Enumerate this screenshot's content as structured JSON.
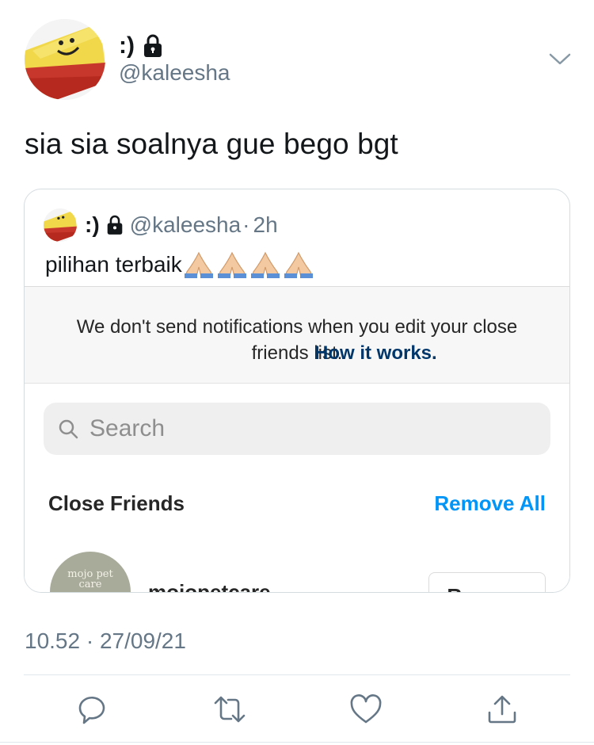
{
  "author": {
    "display_name": ":)",
    "handle": "@kaleesha",
    "avatar": "cake-slice-avatar",
    "protected_icon": "lock-icon"
  },
  "tweet": {
    "text": "sia sia soalnya gue bego bgt",
    "timestamp": "10.52 · 27/09/21"
  },
  "quoted_tweet": {
    "display_name": ":)",
    "handle": "@kaleesha",
    "separator": "·",
    "time": "2h",
    "text": "pilihan terbaik",
    "emoji": [
      "folded-hands",
      "folded-hands",
      "folded-hands",
      "folded-hands"
    ],
    "screenshot": {
      "notice_text": "We don't send notifications when you edit your close friends list.",
      "notice_link": "How it works.",
      "search_placeholder": "Search",
      "section_title": "Close Friends",
      "remove_all_label": "Remove All",
      "first_item": {
        "username": "mojopetcare",
        "avatar_text": "mojo pet care",
        "button_label": "Remove"
      }
    }
  },
  "actions": [
    "reply-icon",
    "retweet-icon",
    "like-icon",
    "share-icon"
  ],
  "colors": {
    "text": "#14171a",
    "muted": "#657786",
    "border": "#e1e8ed",
    "ig_link": "#00376b",
    "ig_blue": "#0095f6"
  }
}
